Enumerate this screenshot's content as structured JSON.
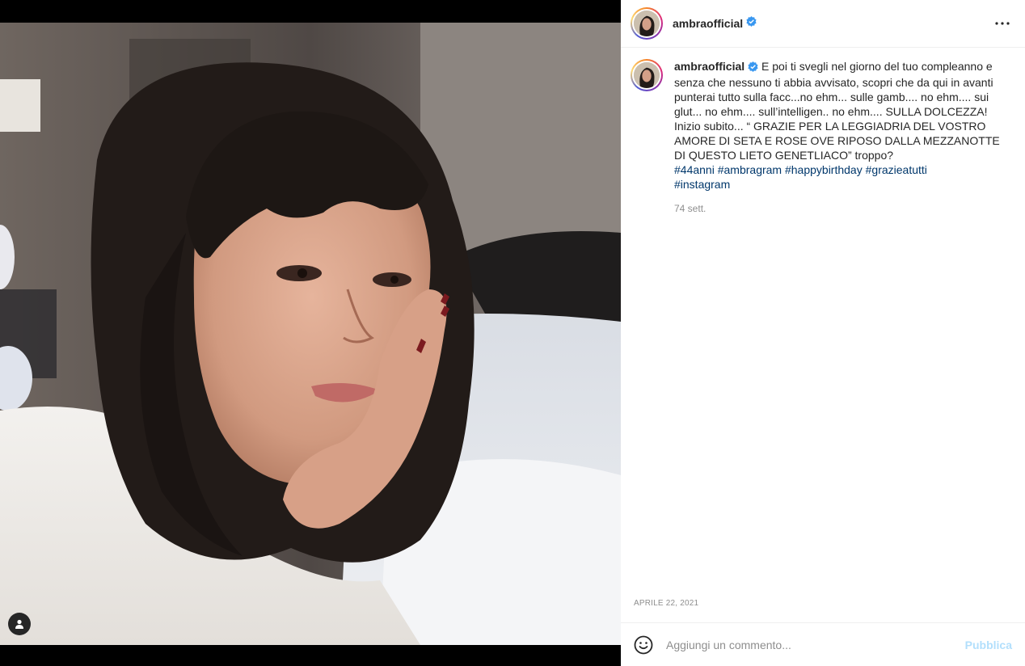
{
  "colors": {
    "accent": "#0095f6",
    "hashtag": "#00376b",
    "publish_disabled": "#b2dffc",
    "muted": "#8e8e8e",
    "verified": "#3897f0"
  },
  "header": {
    "username": "ambraofficial",
    "verified_icon": "verified-badge-icon",
    "more_icon": "more-horizontal-icon"
  },
  "caption": {
    "username": "ambraofficial",
    "text": "E poi ti svegli nel giorno del tuo compleanno e senza che nessuno ti abbia avvisato, scopri che da qui in avanti punterai tutto sulla facc...no ehm... sulle gamb.... no ehm.... sui glut... no ehm.... sull’intelligen.. no ehm.... SULLA DOLCEZZA! Inizio subito... “ GRAZIE PER LA LEGGIADRIA DEL VOSTRO AMORE DI SETA E ROSE OVE RIPOSO DALLA MEZZANOTTE DI QUESTO LIETO GENETLIACO” troppo?",
    "hashtags": [
      "#44anni",
      "#ambragram",
      "#happybirthday",
      "#grazieatutti",
      "#instagram"
    ],
    "time_ago": "74 sett."
  },
  "post_date": "APRILE 22, 2021",
  "comment_box": {
    "placeholder": "Aggiungi un commento...",
    "emoji_icon": "emoji-smile-icon",
    "publish_label": "Pubblica"
  },
  "media": {
    "tag_icon": "user-tag-icon",
    "description": "selfie"
  }
}
